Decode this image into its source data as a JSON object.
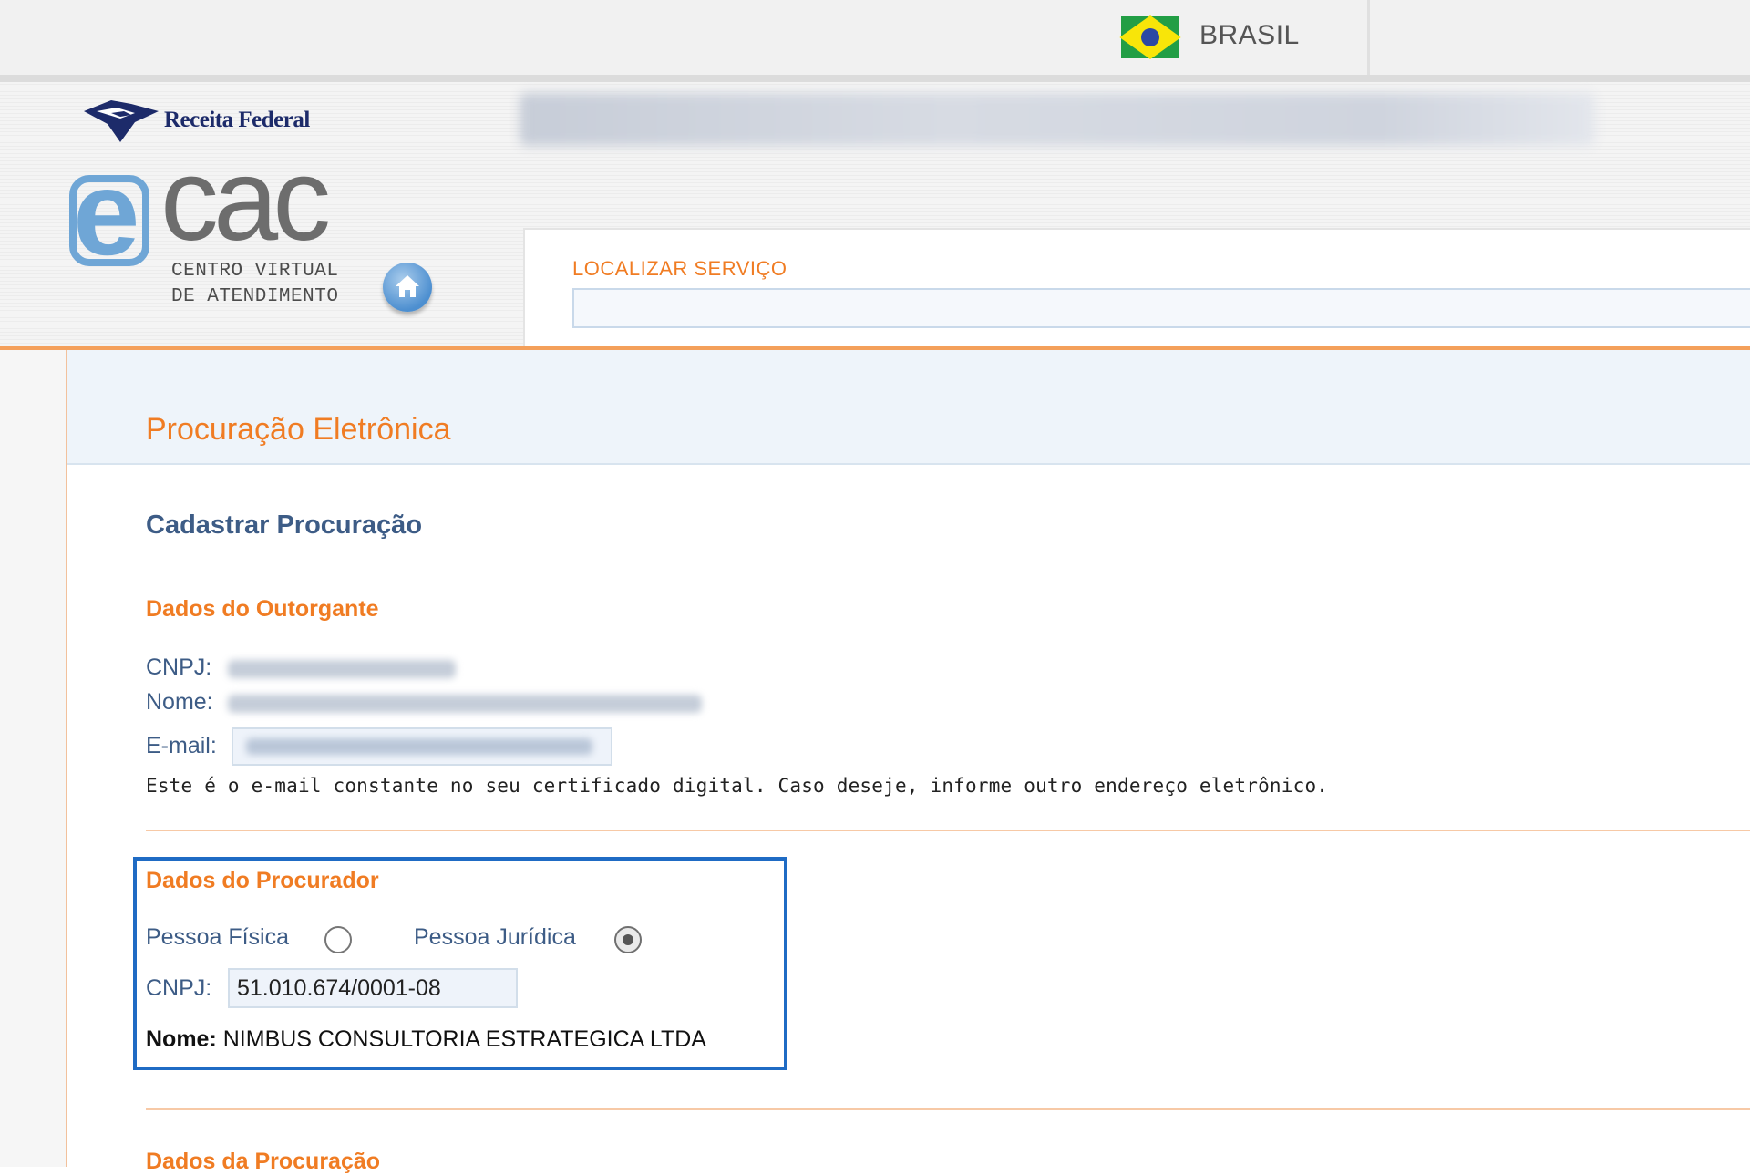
{
  "govbar": {
    "country": "BRASIL"
  },
  "header": {
    "brand": "Receita Federal",
    "ecac": {
      "e": "e",
      "cac": "cac",
      "subtitle_line1": "CENTRO VIRTUAL",
      "subtitle_line2": "DE ATENDIMENTO"
    },
    "home_icon": "home-icon",
    "search": {
      "label": "LOCALIZAR SERVIÇO",
      "value": "",
      "placeholder": ""
    }
  },
  "page": {
    "title": "Procuração Eletrônica",
    "section": "Cadastrar Procuração",
    "outorgante": {
      "heading": "Dados do Outorgante",
      "cnpj_label": "CNPJ:",
      "nome_label": "Nome:",
      "email_label": "E-mail:",
      "email_note": "Este é o e-mail constante no seu certificado digital. Caso deseje, informe outro endereço eletrônico."
    },
    "procurador": {
      "heading": "Dados do Procurador",
      "option_pf": "Pessoa Física",
      "option_pj": "Pessoa Jurídica",
      "selected": "Pessoa Jurídica",
      "cnpj_label": "CNPJ:",
      "cnpj_value": "51.010.674/0001-08",
      "nome_label": "Nome:",
      "nome_value": "NIMBUS CONSULTORIA ESTRATEGICA LTDA"
    },
    "procuracao": {
      "heading": "Dados da Procuração"
    }
  },
  "colors": {
    "accent_orange": "#f07c23",
    "label_blue": "#3d5c86",
    "highlight_blue": "#1f6bc4"
  }
}
